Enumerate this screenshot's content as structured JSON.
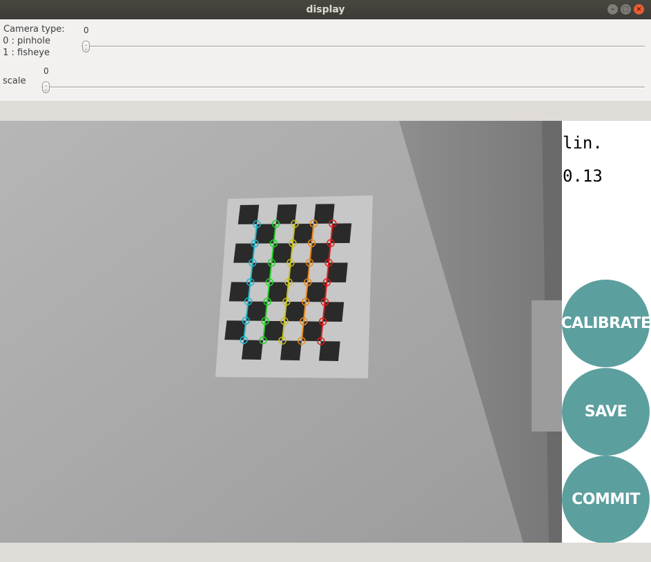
{
  "window": {
    "title": "display"
  },
  "controls": {
    "camera_type": {
      "label_line1": "Camera type:",
      "label_line2": " 0 : pinhole",
      "label_line3": " 1 : fisheye",
      "value": "0"
    },
    "scale": {
      "label": "scale",
      "value": "0"
    }
  },
  "side_panel": {
    "line1": "lin.",
    "line2": "0.13",
    "calibrate_label": "CALIBRATE",
    "save_label": "SAVE",
    "commit_label": "COMMIT",
    "button_color": "#5c9f9f"
  },
  "icons": {
    "minimize": "minimize-icon",
    "maximize": "maximize-icon",
    "close": "close-icon"
  }
}
